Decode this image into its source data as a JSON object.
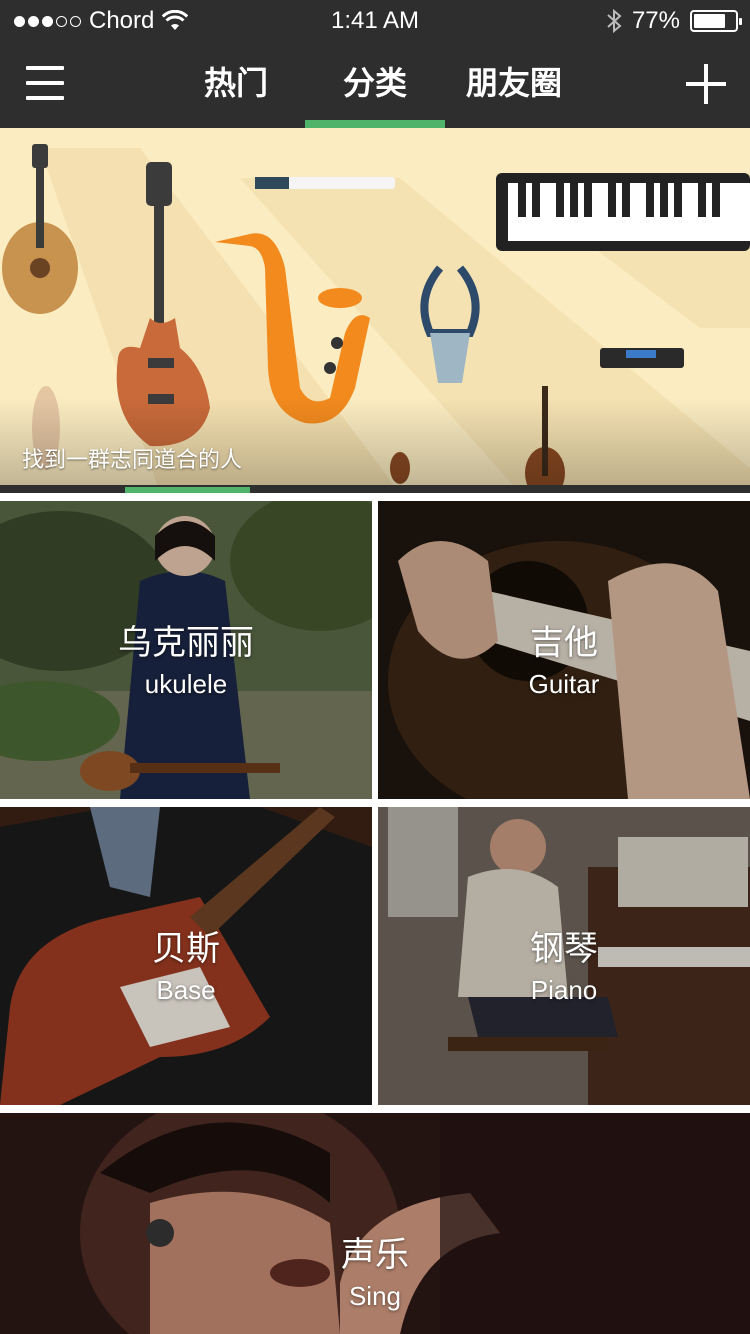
{
  "status_bar": {
    "carrier": "Chord",
    "time": "1:41 AM",
    "battery_percent_text": "77%",
    "battery_level": 0.77,
    "signal_dots_filled": 3,
    "signal_dots_total": 5
  },
  "nav": {
    "menu_icon": "hamburger-menu-icon",
    "tabs": [
      {
        "label": "热门"
      },
      {
        "label": "分类"
      },
      {
        "label": "朋友圈"
      }
    ],
    "active_tab_index": 1,
    "add_icon": "plus-icon",
    "accent_color": "#4fb36a"
  },
  "banner": {
    "caption": "找到一群志同道合的人",
    "slide_index": 1,
    "slide_count": 6
  },
  "categories": [
    {
      "title": "乌克丽丽",
      "subtitle": "ukulele"
    },
    {
      "title": "吉他",
      "subtitle": "Guitar"
    },
    {
      "title": "贝斯",
      "subtitle": "Base"
    },
    {
      "title": "钢琴",
      "subtitle": "Piano"
    },
    {
      "title": "声乐",
      "subtitle": "Sing"
    }
  ]
}
